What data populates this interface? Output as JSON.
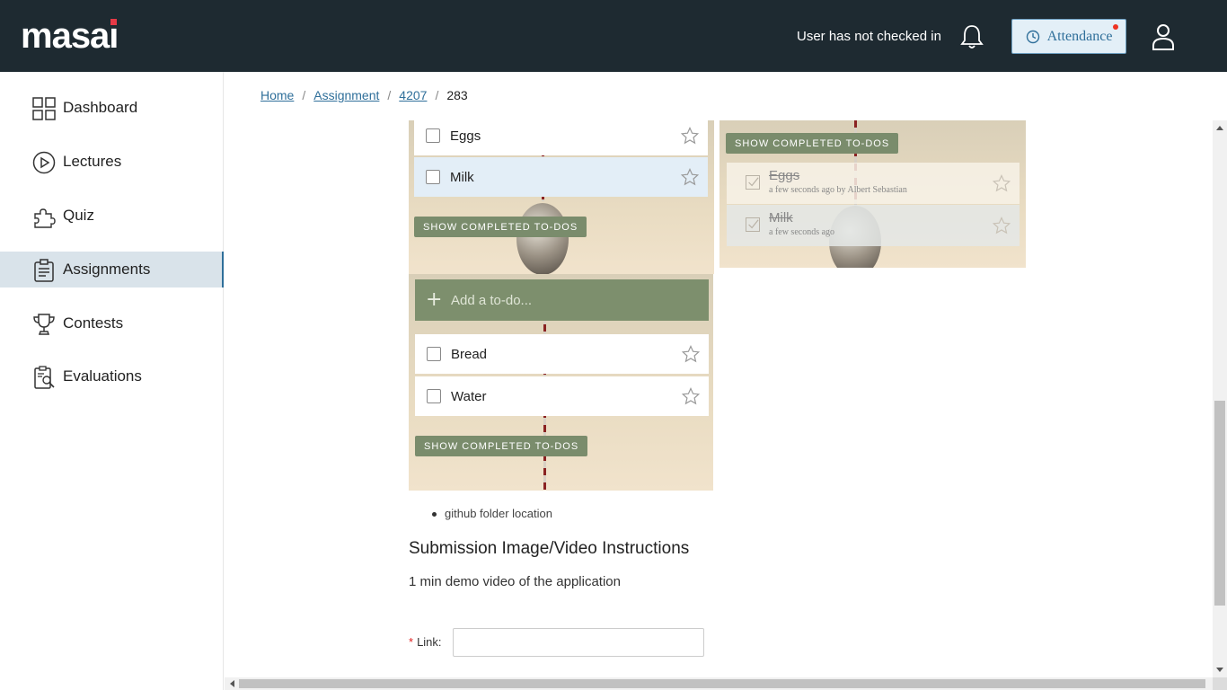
{
  "header": {
    "logo_text": "masai",
    "checkin_status": "User has not checked in",
    "attendance_label": "Attendance"
  },
  "sidebar": {
    "items": [
      {
        "label": "Dashboard",
        "icon": "dashboard-icon"
      },
      {
        "label": "Lectures",
        "icon": "play-icon"
      },
      {
        "label": "Quiz",
        "icon": "puzzle-icon"
      },
      {
        "label": "Assignments",
        "icon": "clipboard-icon",
        "active": true
      },
      {
        "label": "Contests",
        "icon": "trophy-icon"
      },
      {
        "label": "Evaluations",
        "icon": "evaluation-icon"
      }
    ]
  },
  "breadcrumb": {
    "home": "Home",
    "assignment": "Assignment",
    "id": "4207",
    "current": "283"
  },
  "todo_panels": {
    "panel1": {
      "items": [
        "Eggs",
        "Milk"
      ],
      "show_completed": "SHOW COMPLETED TO-DOS"
    },
    "panel2": {
      "show_completed": "SHOW COMPLETED TO-DOS",
      "completed": [
        {
          "text": "Eggs",
          "meta": "a few seconds ago by Albert Sebastian"
        },
        {
          "text": "Milk",
          "meta": "a few seconds ago"
        }
      ]
    },
    "panel3": {
      "add_placeholder": "Add a to-do...",
      "items": [
        "Bread",
        "Water"
      ],
      "show_completed": "SHOW COMPLETED TO-DOS"
    }
  },
  "instructions": {
    "bullet": "github folder location",
    "heading": "Submission Image/Video Instructions",
    "description": "1 min demo video of the application",
    "link_label": "Link",
    "link_required_mark": "*",
    "link_value": ""
  },
  "colors": {
    "topbar": "#1e2a31",
    "accent": "#2f6f9a",
    "active_nav": "#d9e3ea",
    "todo_green": "#7a8c6c"
  }
}
